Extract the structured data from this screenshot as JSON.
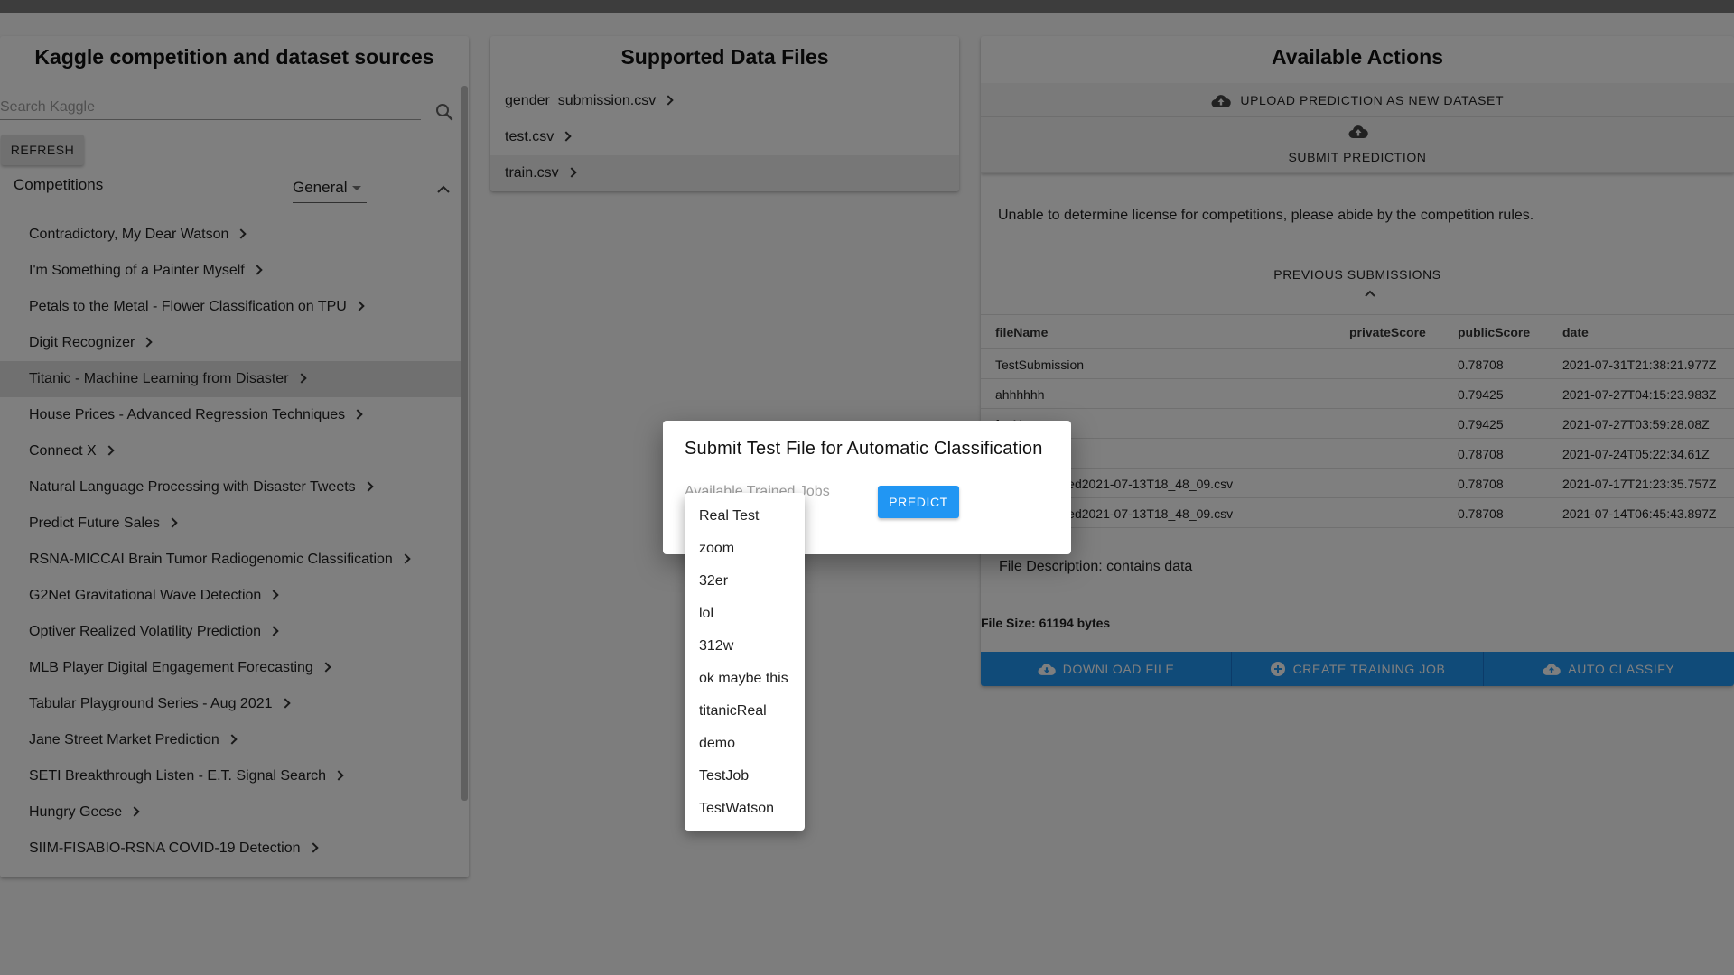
{
  "sources_panel": {
    "title": "Kaggle competition and dataset sources",
    "search": {
      "placeholder": "Search Kaggle",
      "value": ""
    },
    "refresh_label": "REFRESH",
    "competitions_label": "Competitions",
    "category_select": "General",
    "competitions": [
      {
        "label": "Contradictory, My Dear Watson"
      },
      {
        "label": "I'm Something of a Painter Myself"
      },
      {
        "label": "Petals to the Metal - Flower Classification on TPU"
      },
      {
        "label": "Digit Recognizer"
      },
      {
        "label": "Titanic - Machine Learning from Disaster",
        "selected": true
      },
      {
        "label": "House Prices - Advanced Regression Techniques"
      },
      {
        "label": "Connect X"
      },
      {
        "label": "Natural Language Processing with Disaster Tweets"
      },
      {
        "label": "Predict Future Sales"
      },
      {
        "label": "RSNA-MICCAI Brain Tumor Radiogenomic Classification"
      },
      {
        "label": "G2Net Gravitational Wave Detection"
      },
      {
        "label": "Optiver Realized Volatility Prediction"
      },
      {
        "label": "MLB Player Digital Engagement Forecasting"
      },
      {
        "label": "Tabular Playground Series - Aug 2021"
      },
      {
        "label": "Jane Street Market Prediction"
      },
      {
        "label": "SETI Breakthrough Listen - E.T. Signal Search"
      },
      {
        "label": "Hungry Geese"
      },
      {
        "label": "SIIM-FISABIO-RSNA COVID-19 Detection"
      }
    ]
  },
  "files_panel": {
    "title": "Supported Data Files",
    "files": [
      {
        "label": "gender_submission.csv"
      },
      {
        "label": "test.csv"
      },
      {
        "label": "train.csv",
        "selected": true
      }
    ]
  },
  "actions_panel": {
    "title": "Available Actions",
    "upload_label": "UPLOAD PREDICTION AS NEW DATASET",
    "submit_label": "SUBMIT PREDICTION",
    "license_text": "Unable to determine license for competitions, please abide by the competition rules.",
    "previous_submissions_label": "PREVIOUS SUBMISSIONS",
    "table": {
      "headers": [
        "fileName",
        "privateScore",
        "publicScore",
        "date"
      ],
      "rows": [
        [
          "TestSubmission",
          "",
          "0.78708",
          "2021-07-31T21:38:21.977Z"
        ],
        [
          "ahhhhhh",
          "",
          "0.79425",
          "2021-07-27T04:15:23.983Z"
        ],
        [
          "fooNo",
          "",
          "0.79425",
          "2021-07-27T03:59:28.08Z"
        ],
        [
          "",
          "",
          "0.78708",
          "2021-07-24T05:22:34.61Z"
        ],
        [
          "semblesquared2021-07-13T18_48_09.csv",
          "",
          "0.78708",
          "2021-07-17T21:23:35.757Z"
        ],
        [
          "semblesquared2021-07-13T18_48_09.csv",
          "",
          "0.78708",
          "2021-07-14T06:45:43.897Z"
        ]
      ]
    },
    "file_description": "File Description: contains data",
    "file_size": "File Size: 61194 bytes",
    "buttons": {
      "download": "DOWNLOAD FILE",
      "create_training_job": "CREATE TRAINING JOB",
      "auto_classify": "AUTO CLASSIFY"
    }
  },
  "dialog": {
    "title": "Submit Test File for Automatic Classification",
    "jobs_label": "Available Trained Jobs",
    "predict_label": "PREDICT",
    "jobs_options": [
      "Real Test",
      "zoom",
      "32er",
      "lol",
      "312w",
      "ok maybe this",
      "titanicReal",
      "demo",
      "TestJob",
      "TestWatson"
    ]
  },
  "colors": {
    "accent": "#2196f3",
    "overlay": "#000000",
    "selected_row": "#e0e0e0"
  }
}
